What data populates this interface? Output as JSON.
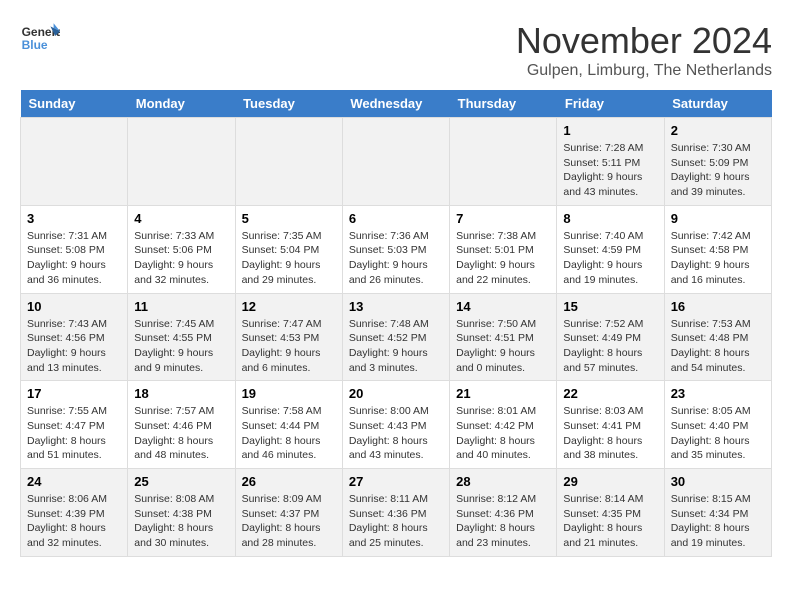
{
  "logo": {
    "line1": "General",
    "line2": "Blue"
  },
  "title": "November 2024",
  "location": "Gulpen, Limburg, The Netherlands",
  "days_of_week": [
    "Sunday",
    "Monday",
    "Tuesday",
    "Wednesday",
    "Thursday",
    "Friday",
    "Saturday"
  ],
  "weeks": [
    [
      {
        "day": "",
        "info": ""
      },
      {
        "day": "",
        "info": ""
      },
      {
        "day": "",
        "info": ""
      },
      {
        "day": "",
        "info": ""
      },
      {
        "day": "",
        "info": ""
      },
      {
        "day": "1",
        "info": "Sunrise: 7:28 AM\nSunset: 5:11 PM\nDaylight: 9 hours and 43 minutes."
      },
      {
        "day": "2",
        "info": "Sunrise: 7:30 AM\nSunset: 5:09 PM\nDaylight: 9 hours and 39 minutes."
      }
    ],
    [
      {
        "day": "3",
        "info": "Sunrise: 7:31 AM\nSunset: 5:08 PM\nDaylight: 9 hours and 36 minutes."
      },
      {
        "day": "4",
        "info": "Sunrise: 7:33 AM\nSunset: 5:06 PM\nDaylight: 9 hours and 32 minutes."
      },
      {
        "day": "5",
        "info": "Sunrise: 7:35 AM\nSunset: 5:04 PM\nDaylight: 9 hours and 29 minutes."
      },
      {
        "day": "6",
        "info": "Sunrise: 7:36 AM\nSunset: 5:03 PM\nDaylight: 9 hours and 26 minutes."
      },
      {
        "day": "7",
        "info": "Sunrise: 7:38 AM\nSunset: 5:01 PM\nDaylight: 9 hours and 22 minutes."
      },
      {
        "day": "8",
        "info": "Sunrise: 7:40 AM\nSunset: 4:59 PM\nDaylight: 9 hours and 19 minutes."
      },
      {
        "day": "9",
        "info": "Sunrise: 7:42 AM\nSunset: 4:58 PM\nDaylight: 9 hours and 16 minutes."
      }
    ],
    [
      {
        "day": "10",
        "info": "Sunrise: 7:43 AM\nSunset: 4:56 PM\nDaylight: 9 hours and 13 minutes."
      },
      {
        "day": "11",
        "info": "Sunrise: 7:45 AM\nSunset: 4:55 PM\nDaylight: 9 hours and 9 minutes."
      },
      {
        "day": "12",
        "info": "Sunrise: 7:47 AM\nSunset: 4:53 PM\nDaylight: 9 hours and 6 minutes."
      },
      {
        "day": "13",
        "info": "Sunrise: 7:48 AM\nSunset: 4:52 PM\nDaylight: 9 hours and 3 minutes."
      },
      {
        "day": "14",
        "info": "Sunrise: 7:50 AM\nSunset: 4:51 PM\nDaylight: 9 hours and 0 minutes."
      },
      {
        "day": "15",
        "info": "Sunrise: 7:52 AM\nSunset: 4:49 PM\nDaylight: 8 hours and 57 minutes."
      },
      {
        "day": "16",
        "info": "Sunrise: 7:53 AM\nSunset: 4:48 PM\nDaylight: 8 hours and 54 minutes."
      }
    ],
    [
      {
        "day": "17",
        "info": "Sunrise: 7:55 AM\nSunset: 4:47 PM\nDaylight: 8 hours and 51 minutes."
      },
      {
        "day": "18",
        "info": "Sunrise: 7:57 AM\nSunset: 4:46 PM\nDaylight: 8 hours and 48 minutes."
      },
      {
        "day": "19",
        "info": "Sunrise: 7:58 AM\nSunset: 4:44 PM\nDaylight: 8 hours and 46 minutes."
      },
      {
        "day": "20",
        "info": "Sunrise: 8:00 AM\nSunset: 4:43 PM\nDaylight: 8 hours and 43 minutes."
      },
      {
        "day": "21",
        "info": "Sunrise: 8:01 AM\nSunset: 4:42 PM\nDaylight: 8 hours and 40 minutes."
      },
      {
        "day": "22",
        "info": "Sunrise: 8:03 AM\nSunset: 4:41 PM\nDaylight: 8 hours and 38 minutes."
      },
      {
        "day": "23",
        "info": "Sunrise: 8:05 AM\nSunset: 4:40 PM\nDaylight: 8 hours and 35 minutes."
      }
    ],
    [
      {
        "day": "24",
        "info": "Sunrise: 8:06 AM\nSunset: 4:39 PM\nDaylight: 8 hours and 32 minutes."
      },
      {
        "day": "25",
        "info": "Sunrise: 8:08 AM\nSunset: 4:38 PM\nDaylight: 8 hours and 30 minutes."
      },
      {
        "day": "26",
        "info": "Sunrise: 8:09 AM\nSunset: 4:37 PM\nDaylight: 8 hours and 28 minutes."
      },
      {
        "day": "27",
        "info": "Sunrise: 8:11 AM\nSunset: 4:36 PM\nDaylight: 8 hours and 25 minutes."
      },
      {
        "day": "28",
        "info": "Sunrise: 8:12 AM\nSunset: 4:36 PM\nDaylight: 8 hours and 23 minutes."
      },
      {
        "day": "29",
        "info": "Sunrise: 8:14 AM\nSunset: 4:35 PM\nDaylight: 8 hours and 21 minutes."
      },
      {
        "day": "30",
        "info": "Sunrise: 8:15 AM\nSunset: 4:34 PM\nDaylight: 8 hours and 19 minutes."
      }
    ]
  ]
}
